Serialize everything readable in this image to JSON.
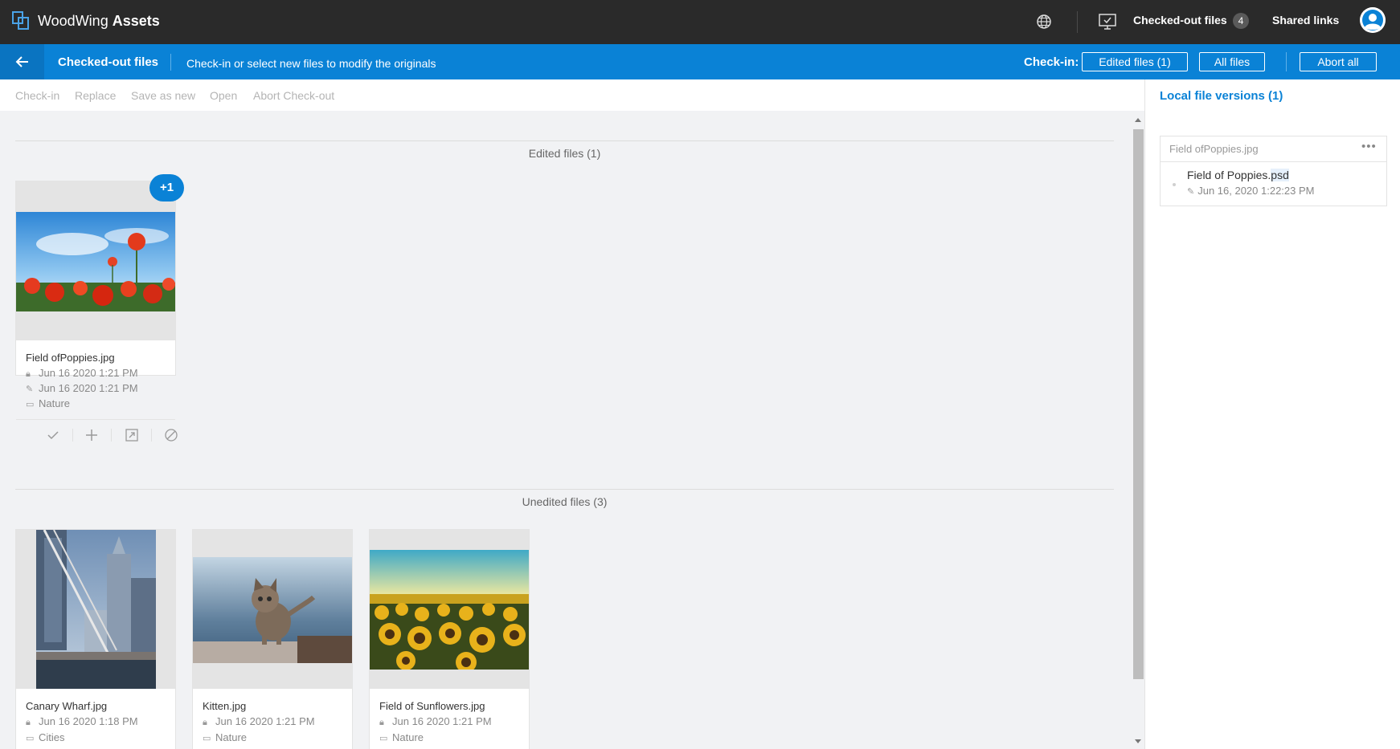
{
  "app": {
    "brand_prefix": "WoodWing",
    "brand_name": "Assets"
  },
  "topnav": {
    "checked_out_label": "Checked-out files",
    "checked_out_count": "4",
    "shared_links_label": "Shared links"
  },
  "subbar": {
    "title": "Checked-out files",
    "description": "Check-in or select new files to modify the originals",
    "checkin_label": "Check-in:",
    "buttons": {
      "edited": "Edited files (1)",
      "all": "All files",
      "abort_all": "Abort all"
    }
  },
  "toolbar": {
    "checkin": "Check-in",
    "replace": "Replace",
    "save_as_new": "Save as new",
    "open": "Open",
    "abort_checkout": "Abort Check-out"
  },
  "edited_section": {
    "title": "Edited files (1)",
    "files": [
      {
        "name": "Field ofPoppies.jpg",
        "checked_out": "Jun 16 2020 1:21 PM",
        "edited": "Jun 16 2020 1:21 PM",
        "folder": "Nature",
        "badge": "+1"
      }
    ]
  },
  "unedited_section": {
    "title": "Unedited files (3)",
    "files": [
      {
        "name": "Canary Wharf.jpg",
        "checked_out": "Jun 16 2020 1:18 PM",
        "folder": "Cities"
      },
      {
        "name": "Kitten.jpg",
        "checked_out": "Jun 16 2020 1:21 PM",
        "folder": "Nature"
      },
      {
        "name": "Field of Sunflowers.jpg",
        "checked_out": "Jun 16 2020 1:21 PM",
        "folder": "Nature"
      }
    ]
  },
  "side_panel": {
    "title": "Local file versions (1)",
    "group_name": "Field ofPoppies.jpg",
    "version": {
      "file_base": "Field of Poppies.",
      "file_ext": "psd",
      "date": "Jun 16, 2020 1:22:23 PM"
    }
  },
  "colors": {
    "topbar": "#2a2a2a",
    "accent": "#0a82d6",
    "background": "#f1f2f4"
  }
}
